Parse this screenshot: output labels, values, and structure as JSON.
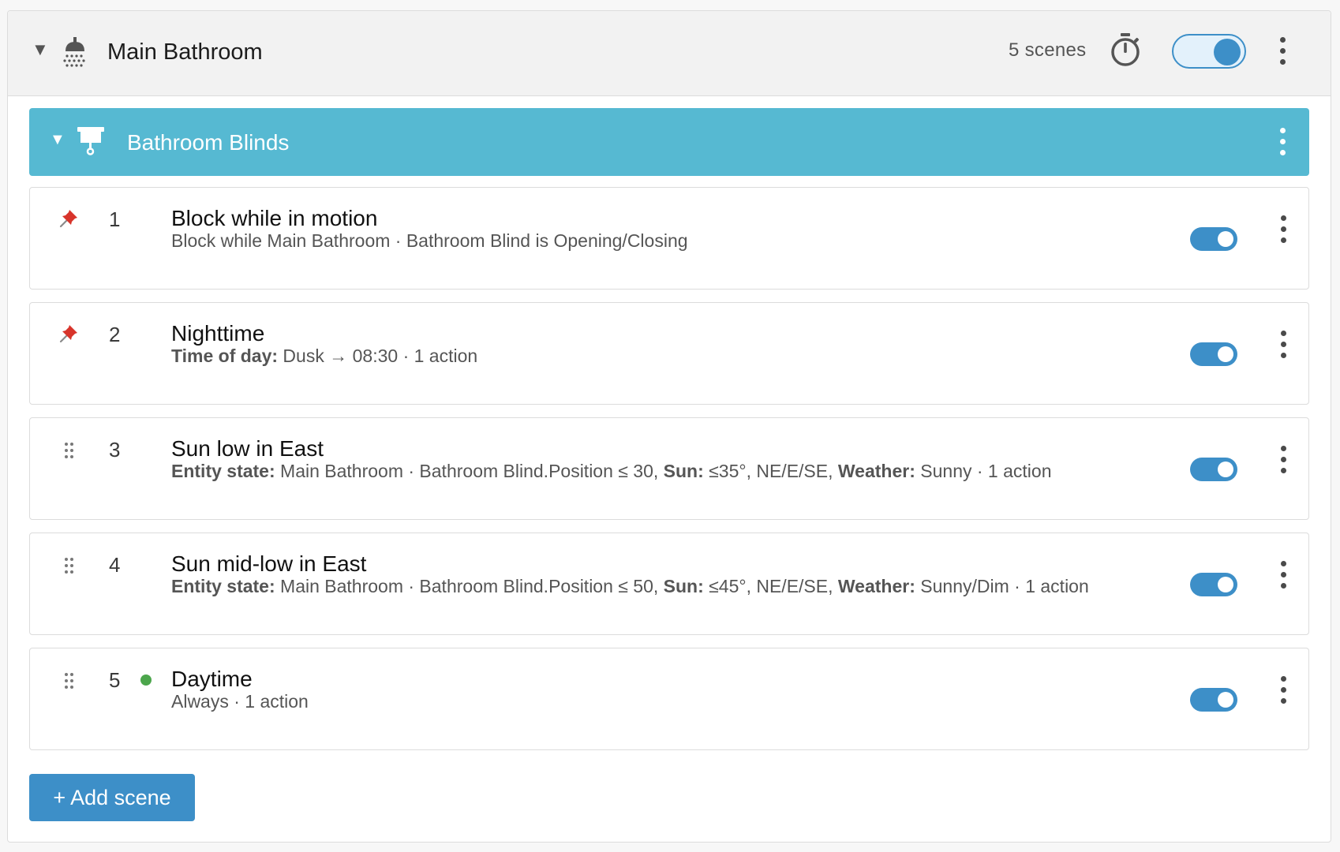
{
  "group": {
    "title": "Main Bathroom",
    "scene_count": "5 scenes",
    "enabled": true,
    "icons": {
      "collapse": "caret-down-icon",
      "room": "shower-icon",
      "timer": "timer-icon",
      "menu": "kebab-menu-icon"
    }
  },
  "subgroup": {
    "title": "Bathroom Blinds",
    "icons": {
      "collapse": "caret-down-icon",
      "device": "blind-icon",
      "menu": "kebab-menu-icon"
    }
  },
  "colors": {
    "accent": "#3d8fc8",
    "subgroup_header": "#56b9d2",
    "pin": "#d8342b",
    "active_dot": "#4ca64c"
  },
  "scenes": [
    {
      "number": "1",
      "handle": "pin-icon",
      "title": "Block while in motion",
      "subtitle": [
        {
          "text": "Block while Main Bathroom · Bathroom Blind is Opening/Closing",
          "bold": false
        }
      ],
      "enabled": true
    },
    {
      "number": "2",
      "handle": "pin-icon",
      "title": "Nighttime",
      "subtitle": [
        {
          "text": "Time of day:",
          "bold": true
        },
        {
          "text": " Dusk → 08:30 · 1 action",
          "bold": false
        }
      ],
      "enabled": true
    },
    {
      "number": "3",
      "handle": "drag-handle-icon",
      "title": "Sun low in East",
      "subtitle": [
        {
          "text": "Entity state:",
          "bold": true
        },
        {
          "text": " Main Bathroom · Bathroom Blind.Position ≤ 30, ",
          "bold": false
        },
        {
          "text": "Sun:",
          "bold": true
        },
        {
          "text": " ≤35°, NE/E/SE, ",
          "bold": false
        },
        {
          "text": "Weather:",
          "bold": true
        },
        {
          "text": " Sunny · 1 action",
          "bold": false
        }
      ],
      "enabled": true
    },
    {
      "number": "4",
      "handle": "drag-handle-icon",
      "title": "Sun mid-low in East",
      "subtitle": [
        {
          "text": "Entity state:",
          "bold": true
        },
        {
          "text": " Main Bathroom · Bathroom Blind.Position ≤ 50, ",
          "bold": false
        },
        {
          "text": "Sun:",
          "bold": true
        },
        {
          "text": " ≤45°, NE/E/SE, ",
          "bold": false
        },
        {
          "text": "Weather:",
          "bold": true
        },
        {
          "text": " Sunny/Dim · 1 action",
          "bold": false
        }
      ],
      "enabled": true
    },
    {
      "number": "5",
      "handle": "drag-handle-icon",
      "active": true,
      "title": "Daytime",
      "subtitle": [
        {
          "text": "Always · 1 action",
          "bold": false
        }
      ],
      "enabled": true
    }
  ],
  "add_button": "+ Add scene"
}
